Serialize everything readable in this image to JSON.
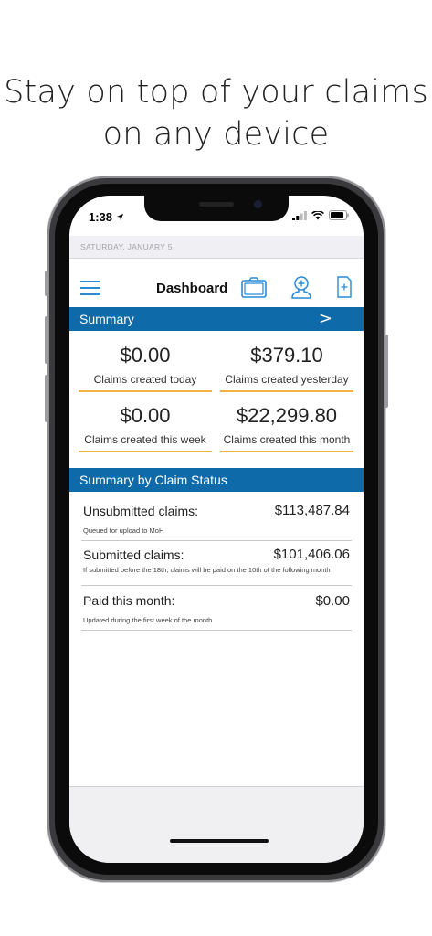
{
  "headline": {
    "line1": "Stay on top of your claims",
    "line2": "on any device"
  },
  "status_bar": {
    "time": "1:38"
  },
  "date_banner": "SATURDAY, JANUARY 5",
  "navbar": {
    "title": "Dashboard",
    "icons": [
      "menu-icon",
      "camera-icon",
      "add-patient-icon",
      "new-document-icon"
    ]
  },
  "summary": {
    "title": "Summary",
    "chevron": ">",
    "metrics": [
      {
        "value": "$0.00",
        "label": "Claims created today"
      },
      {
        "value": "$379.10",
        "label": "Claims created yesterday"
      },
      {
        "value": "$0.00",
        "label": "Claims created this week"
      },
      {
        "value": "$22,299.80",
        "label": "Claims created this month"
      }
    ]
  },
  "status_section": {
    "title": "Summary by Claim Status",
    "rows": [
      {
        "name": "Unsubmitted claims:",
        "amount": "$113,487.84",
        "note": "Queued for upload to MoH"
      },
      {
        "name": "Submitted claims:",
        "amount": "$101,406.06",
        "note": "If submitted before the 18th, claims will be paid on the 10th of the following month"
      },
      {
        "name": "Paid this month:",
        "amount": "$0.00",
        "note": "Updated during the first week of the month"
      }
    ]
  },
  "colors": {
    "accent_blue": "#0e6aa8",
    "underline_orange": "#f0b244",
    "icon_blue": "#2a8ad6"
  }
}
